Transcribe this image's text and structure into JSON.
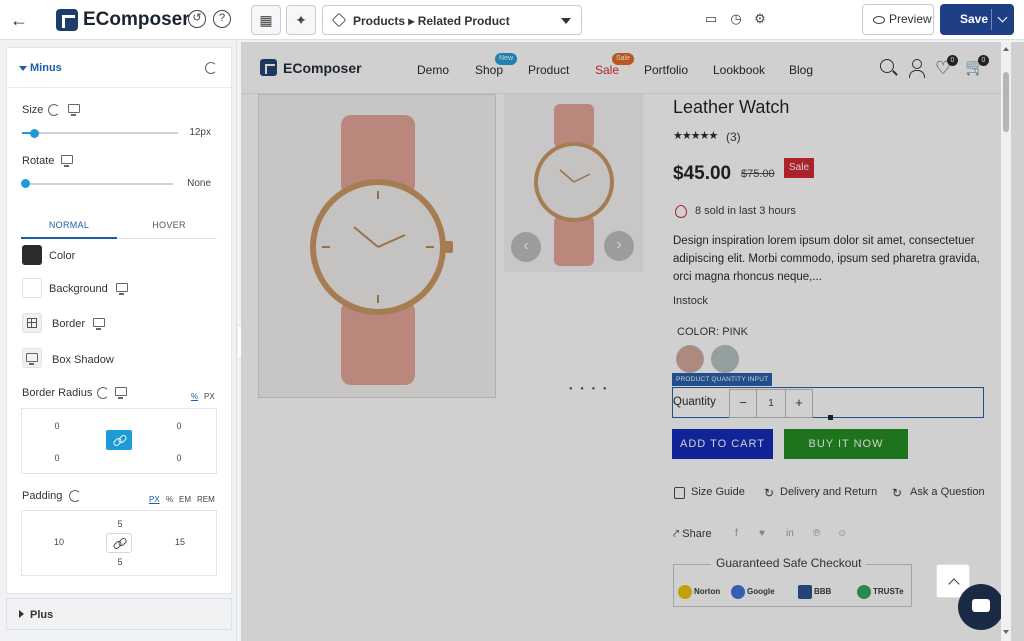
{
  "app": {
    "brand": "EComposer",
    "page_selector": "Products ▸ Related Product",
    "preview_label": "Preview",
    "save_label": "Save"
  },
  "panel": {
    "section_title": "Minus",
    "size_label": "Size",
    "size_value": "12px",
    "size_fraction": 0.08,
    "rotate_label": "Rotate",
    "rotate_value": "None",
    "tabs": [
      "NORMAL",
      "HOVER"
    ],
    "active_tab": "NORMAL",
    "color_label": "Color",
    "color_value": "#2c2c2c",
    "background_label": "Background",
    "border_label": "Border",
    "box_shadow_label": "Box Shadow",
    "border_radius_label": "Border Radius",
    "border_radius_units": [
      "%",
      "PX"
    ],
    "border_radius_values": [
      "0",
      "0",
      "0",
      "0"
    ],
    "padding_label": "Padding",
    "padding_units": [
      "PX",
      "%",
      "EM",
      "REM"
    ],
    "padding": {
      "top": "5",
      "left": "10",
      "right": "15",
      "bottom": "5"
    },
    "next_section_title": "Plus"
  },
  "site": {
    "brand": "EComposer",
    "nav": [
      {
        "label": "Demo"
      },
      {
        "label": "Shop",
        "badge": "New",
        "badge_color": "#1e9ad6"
      },
      {
        "label": "Product"
      },
      {
        "label": "Sale",
        "badge": "Sale",
        "badge_color": "#e0661c"
      },
      {
        "label": "Portfolio"
      },
      {
        "label": "Lookbook"
      },
      {
        "label": "Blog"
      }
    ],
    "wishlist_count": "0",
    "cart_count": "0"
  },
  "product": {
    "name": "Leather Watch",
    "stars": "★★★★★",
    "rating": 5,
    "review_count": "(3)",
    "price": "$45.00",
    "compare_price": "$75.00",
    "sale_badge": "Sale",
    "sold_text": "8 sold in last 3 hours",
    "description": "Design inspiration lorem ipsum dolor sit amet, consectetuer adipiscing elit. Morbi commodo, ipsum sed pharetra gravida, orci magna rhoncus neque,...",
    "stock": "Instock",
    "color_label": "COLOR: PINK",
    "swatches": [
      "#d4a598",
      "#b3c1c0"
    ],
    "selected_element_tag": "PRODUCT QUANTITY INPUT",
    "quantity_label": "Quantity",
    "quantity_value": "1",
    "minus": "−",
    "plus": "+",
    "add_to_cart": "ADD TO CART",
    "buy_now": "BUY IT NOW",
    "size_guide": "Size Guide",
    "delivery": "Delivery and Return",
    "ask": "Ask a Question",
    "share": "Share",
    "trust_title": "Guaranteed Safe Checkout",
    "trust_logos": [
      "Norton",
      "Google",
      "BBB",
      "TRUSTe"
    ],
    "image_prev": "‹",
    "image_next": "›",
    "image_dots": "● ● ● ●"
  }
}
